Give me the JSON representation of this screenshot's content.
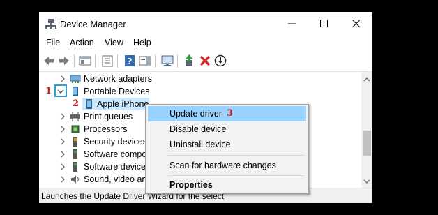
{
  "window": {
    "title": "Device Manager",
    "menu": [
      "File",
      "Action",
      "View",
      "Help"
    ],
    "toolbar_icons": [
      "back-arrow-icon",
      "forward-arrow-icon",
      "console-tree-icon",
      "properties-icon",
      "help-icon",
      "action-pane-icon",
      "monitor-icon",
      "update-driver-icon",
      "uninstall-icon",
      "download-icon"
    ]
  },
  "tree": {
    "items": [
      {
        "label": "Network adapters",
        "icon": "network-adapter-icon",
        "expanded": false
      },
      {
        "label": "Portable Devices",
        "icon": "portable-device-icon",
        "expanded": true
      },
      {
        "label": "Apple iPhone",
        "icon": "phone-icon",
        "child": true
      },
      {
        "label": "Print queues",
        "icon": "printer-icon",
        "expanded": false
      },
      {
        "label": "Processors",
        "icon": "processor-icon",
        "expanded": false
      },
      {
        "label": "Security devices",
        "icon": "security-device-icon",
        "expanded": false
      },
      {
        "label": "Software compo",
        "icon": "software-component-icon",
        "expanded": false
      },
      {
        "label": "Software devices",
        "icon": "software-device-icon",
        "expanded": false
      },
      {
        "label": "Sound, video and",
        "icon": "sound-icon",
        "expanded": false
      }
    ]
  },
  "context_menu": {
    "items": [
      "Update driver",
      "Disable device",
      "Uninstall device",
      "Scan for hardware changes",
      "Properties"
    ]
  },
  "annotations": {
    "step1": "1",
    "step2": "2",
    "step3": "3"
  },
  "status": {
    "text": "Launches the Update Driver Wizard for the select"
  },
  "colors": {
    "selection": "#cce8ff",
    "highlight": "#99d1ff",
    "annotation": "#d11f1f",
    "focus_box": "#2a9fd6"
  }
}
